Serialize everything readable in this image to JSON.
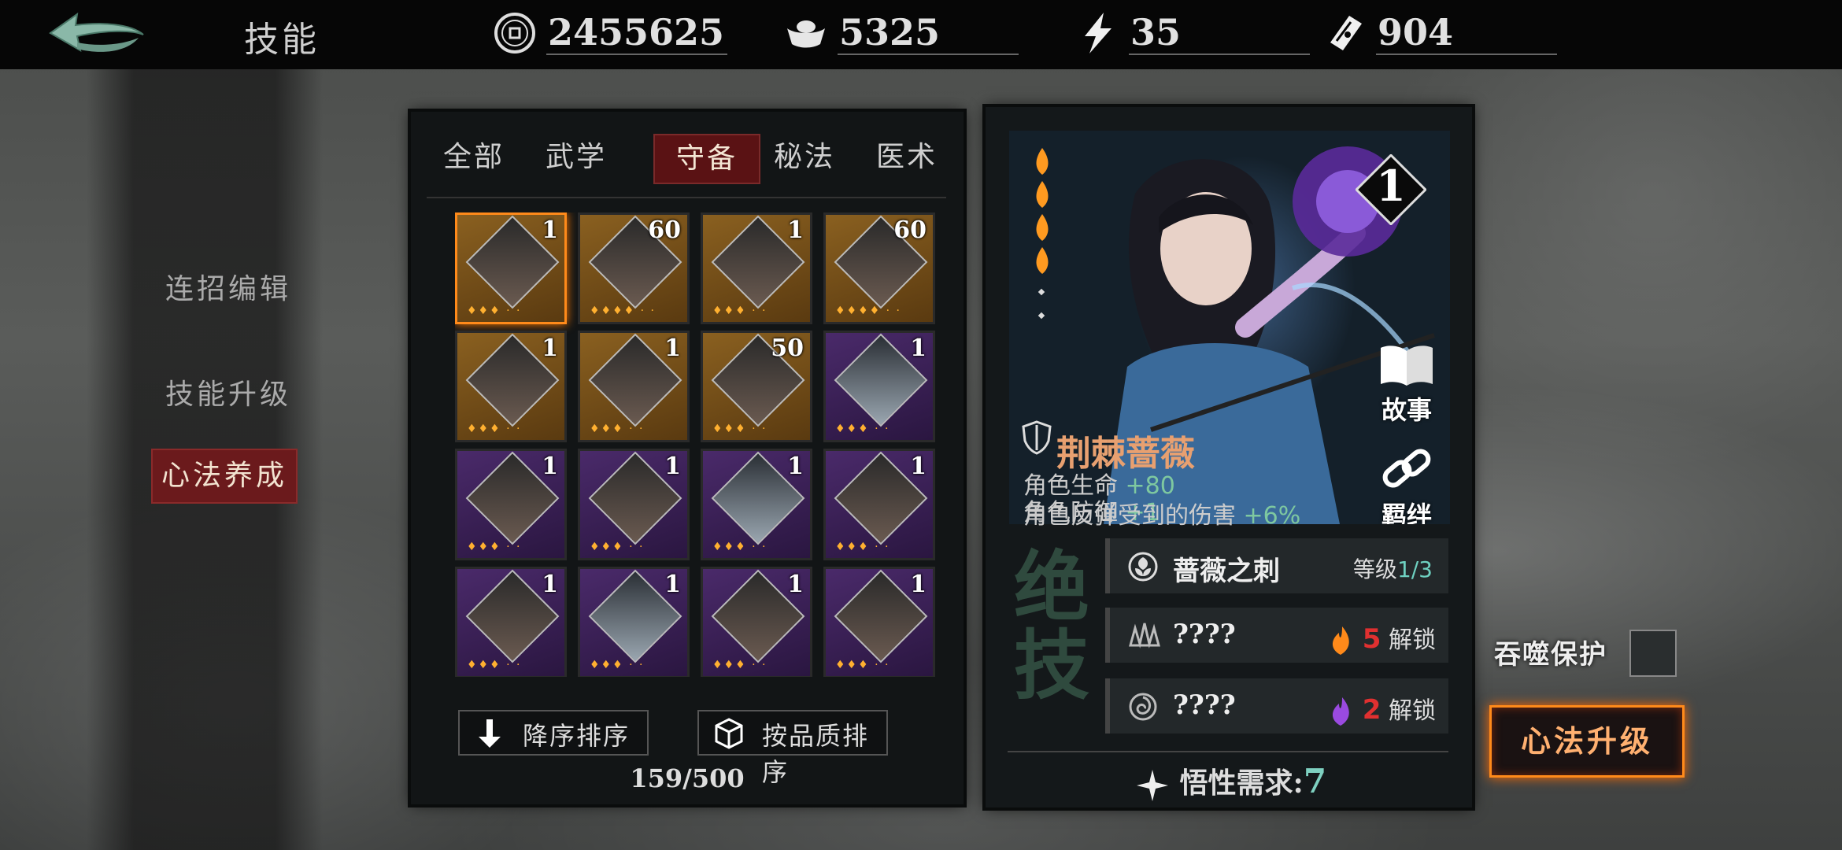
{
  "header": {
    "title": "技能",
    "resources": [
      {
        "icon": "coin-icon",
        "value": "2455625"
      },
      {
        "icon": "ingot-icon",
        "value": "5325"
      },
      {
        "icon": "lightning-icon",
        "value": "35"
      },
      {
        "icon": "ticket-icon",
        "value": "904"
      }
    ]
  },
  "side_menu": {
    "items": [
      "连招编辑",
      "技能升级",
      "心法养成"
    ],
    "active": "心法养成"
  },
  "list_panel": {
    "tabs": [
      "全部",
      "武学",
      "守备",
      "秘法",
      "医术"
    ],
    "active_tab": "守备",
    "cards": [
      {
        "count": "1",
        "tier": "gold",
        "flames": 3,
        "selected": true
      },
      {
        "count": "60",
        "tier": "gold",
        "flames": 4
      },
      {
        "count": "1",
        "tier": "gold",
        "flames": 3
      },
      {
        "count": "60",
        "tier": "gold",
        "flames": 4
      },
      {
        "count": "1",
        "tier": "gold",
        "flames": 3
      },
      {
        "count": "1",
        "tier": "gold",
        "flames": 3
      },
      {
        "count": "50",
        "tier": "gold",
        "flames": 3
      },
      {
        "count": "1",
        "tier": "purple",
        "flames": 3
      },
      {
        "count": "1",
        "tier": "purple",
        "flames": 3
      },
      {
        "count": "1",
        "tier": "purple",
        "flames": 3
      },
      {
        "count": "1",
        "tier": "purple",
        "flames": 3
      },
      {
        "count": "1",
        "tier": "purple",
        "flames": 3
      },
      {
        "count": "1",
        "tier": "purple",
        "flames": 3
      },
      {
        "count": "1",
        "tier": "purple",
        "flames": 3
      },
      {
        "count": "1",
        "tier": "purple",
        "flames": 3
      },
      {
        "count": "1",
        "tier": "purple",
        "flames": 3
      }
    ],
    "sort_desc_label": "降序排序",
    "sort_quality_label": "按品质排序",
    "count_text": "159/500"
  },
  "detail": {
    "level": "1",
    "story_label": "故事",
    "bond_label": "羁绊",
    "name": "荆棘蔷薇",
    "stats": [
      {
        "label": "角色生命",
        "bonus": "+80"
      },
      {
        "label": "角色防御",
        "bonus": "+1"
      },
      {
        "label": "角色反弹受到的伤害",
        "bonus": "+6%"
      }
    ],
    "side_vertical_text": "绝技",
    "skills": [
      {
        "name": "蔷薇之刺",
        "level_label": "等级",
        "level_value": "1/3"
      },
      {
        "name": "????",
        "req_num": "5",
        "req_label": "解锁"
      },
      {
        "name": "????",
        "req_num": "2",
        "req_label": "解锁"
      }
    ],
    "wuxing_label": "悟性需求:",
    "wuxing_value": "7"
  },
  "right": {
    "protect_label": "吞噬保护",
    "upgrade_label": "心法升级"
  },
  "colors": {
    "accent_orange": "#ff8a1a",
    "tab_active": "#5a1214",
    "bonus_green": "#7ec8a0",
    "lock_red": "#e03030"
  }
}
